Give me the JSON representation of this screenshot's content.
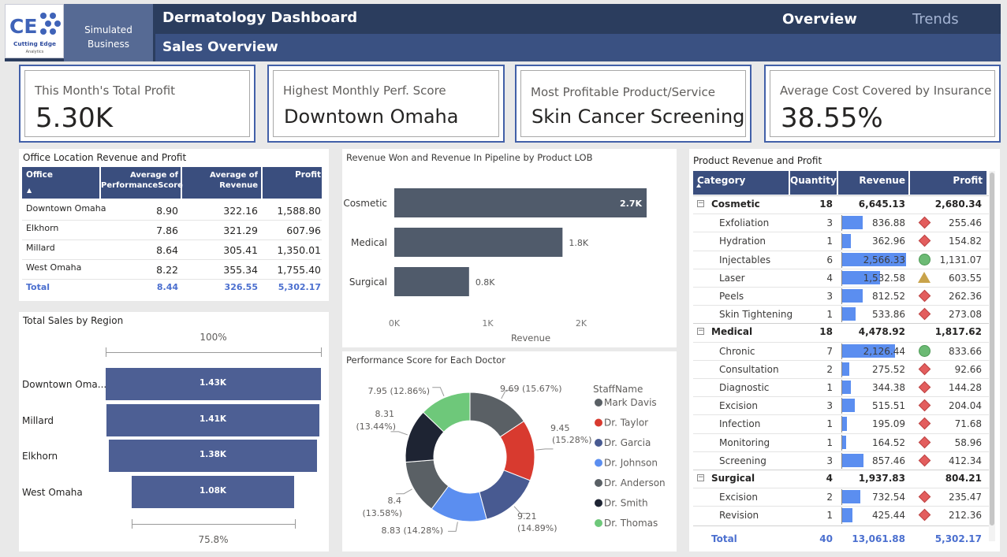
{
  "header": {
    "logo_text": "Cutting Edge",
    "logo_sub": "Analytics",
    "simulated_line1": "Simulated",
    "simulated_line2": "Business",
    "title": "Dermatology Dashboard",
    "subtitle": "Sales Overview",
    "nav_overview": "Overview",
    "nav_trends": "Trends"
  },
  "kpis": [
    {
      "label": "This Month's Total Profit",
      "value": "5.30K"
    },
    {
      "label": "Highest Monthly Perf. Score",
      "value": "Downtown Omaha"
    },
    {
      "label": "Most Profitable Product/Service",
      "value": "Skin Cancer Screening"
    },
    {
      "label": "Average Cost Covered by Insurance",
      "value": "38.55%"
    }
  ],
  "office_table": {
    "title": "Office Location Revenue and Profit",
    "headers": [
      "Office",
      "Average of PerformanceScore",
      "Average of Revenue",
      "Profit"
    ],
    "rows": [
      [
        "Downtown Omaha",
        "8.90",
        "322.16",
        "1,588.80"
      ],
      [
        "Elkhorn",
        "7.86",
        "321.29",
        "607.96"
      ],
      [
        "Millard",
        "8.64",
        "305.41",
        "1,350.01"
      ],
      [
        "West Omaha",
        "8.22",
        "355.34",
        "1,755.40"
      ]
    ],
    "total": [
      "Total",
      "8.44",
      "326.55",
      "5,302.17"
    ]
  },
  "region_funnel": {
    "title": "Total Sales by Region",
    "top_label": "100%",
    "bottom_label": "75.8%",
    "rows": [
      {
        "name": "Downtown Oma...",
        "value": 1430,
        "label": "1.43K"
      },
      {
        "name": "Millard",
        "value": 1410,
        "label": "1.41K"
      },
      {
        "name": "Elkhorn",
        "value": 1380,
        "label": "1.38K"
      },
      {
        "name": "West Omaha",
        "value": 1080,
        "label": "1.08K"
      }
    ]
  },
  "chart_data": [
    {
      "type": "bar",
      "title": "Revenue Won and Revenue In Pipeline by Product LOB",
      "orientation": "horizontal",
      "categories": [
        "Cosmetic",
        "Medical",
        "Surgical"
      ],
      "values": [
        2700,
        1800,
        800
      ],
      "data_labels": [
        "2.7K",
        "1.8K",
        "0.8K"
      ],
      "xlabel": "Revenue",
      "xticks": [
        "0K",
        "1K",
        "2K"
      ],
      "xlim": [
        0,
        2700
      ],
      "color": "#505b6b"
    },
    {
      "type": "pie",
      "title": "Performance Score for Each Doctor",
      "donut": true,
      "legend_title": "StaffName",
      "legend_position": "right",
      "slices": [
        {
          "name": "Mark Davis",
          "value": 9.69,
          "label": "9.69 (15.67%)",
          "color": "#5a6065"
        },
        {
          "name": "Dr. Taylor",
          "value": 9.45,
          "label_a": "9.45",
          "label_b": "(15.28%)",
          "color": "#d83a2f"
        },
        {
          "name": "Dr. Garcia",
          "value": 9.21,
          "label_a": "9.21",
          "label_b": "(14.89%)",
          "color": "#485a91"
        },
        {
          "name": "Dr. Johnson",
          "value": 8.83,
          "label": "8.83 (14.28%)",
          "color": "#5b8ef0"
        },
        {
          "name": "Dr. Anderson",
          "value": 8.4,
          "label_a": "8.4",
          "label_b": "(13.58%)",
          "color": "#5a6065"
        },
        {
          "name": "Dr. Smith",
          "value": 8.31,
          "label_a": "8.31",
          "label_b": "(13.44%)",
          "color": "#1e2433"
        },
        {
          "name": "Dr. Thomas",
          "value": 7.95,
          "label": "7.95 (12.86%)",
          "color": "#6ec87a"
        }
      ]
    }
  ],
  "product_table": {
    "title": "Product Revenue and Profit",
    "headers": [
      "Category",
      "Quantity",
      "Revenue",
      "Profit"
    ],
    "max_revenue": 2566.33,
    "groups": [
      {
        "name": "Cosmetic",
        "qty": "18",
        "revenue": "6,645.13",
        "profit": "2,680.34",
        "items": [
          {
            "name": "Exfoliation",
            "qty": "3",
            "revenue": "836.88",
            "rev": 836.88,
            "profit": "255.46",
            "kpi": "diamond"
          },
          {
            "name": "Hydration",
            "qty": "1",
            "revenue": "362.96",
            "rev": 362.96,
            "profit": "154.82",
            "kpi": "diamond"
          },
          {
            "name": "Injectables",
            "qty": "6",
            "revenue": "2,566.33",
            "rev": 2566.33,
            "profit": "1,131.07",
            "kpi": "circle"
          },
          {
            "name": "Laser",
            "qty": "4",
            "revenue": "1,532.58",
            "rev": 1532.58,
            "profit": "603.55",
            "kpi": "triangle"
          },
          {
            "name": "Peels",
            "qty": "3",
            "revenue": "812.52",
            "rev": 812.52,
            "profit": "262.36",
            "kpi": "diamond"
          },
          {
            "name": "Skin Tightening",
            "qty": "1",
            "revenue": "533.86",
            "rev": 533.86,
            "profit": "273.08",
            "kpi": "diamond"
          }
        ]
      },
      {
        "name": "Medical",
        "qty": "18",
        "revenue": "4,478.92",
        "profit": "1,817.62",
        "items": [
          {
            "name": "Chronic",
            "qty": "7",
            "revenue": "2,126.44",
            "rev": 2126.44,
            "profit": "833.66",
            "kpi": "circle"
          },
          {
            "name": "Consultation",
            "qty": "2",
            "revenue": "275.52",
            "rev": 275.52,
            "profit": "92.66",
            "kpi": "diamond"
          },
          {
            "name": "Diagnostic",
            "qty": "1",
            "revenue": "344.38",
            "rev": 344.38,
            "profit": "144.28",
            "kpi": "diamond"
          },
          {
            "name": "Excision",
            "qty": "3",
            "revenue": "515.51",
            "rev": 515.51,
            "profit": "204.04",
            "kpi": "diamond"
          },
          {
            "name": "Infection",
            "qty": "1",
            "revenue": "195.09",
            "rev": 195.09,
            "profit": "71.68",
            "kpi": "diamond"
          },
          {
            "name": "Monitoring",
            "qty": "1",
            "revenue": "164.52",
            "rev": 164.52,
            "profit": "58.96",
            "kpi": "diamond"
          },
          {
            "name": "Screening",
            "qty": "3",
            "revenue": "857.46",
            "rev": 857.46,
            "profit": "412.34",
            "kpi": "diamond"
          }
        ]
      },
      {
        "name": "Surgical",
        "qty": "4",
        "revenue": "1,937.83",
        "profit": "804.21",
        "items": [
          {
            "name": "Excision",
            "qty": "2",
            "revenue": "732.54",
            "rev": 732.54,
            "profit": "235.47",
            "kpi": "diamond"
          },
          {
            "name": "Revision",
            "qty": "1",
            "revenue": "425.44",
            "rev": 425.44,
            "profit": "212.36",
            "kpi": "diamond"
          }
        ]
      }
    ],
    "total": [
      "Total",
      "40",
      "13,061.88",
      "5,302.17"
    ]
  },
  "colors": {
    "navy": "#2b3d5e",
    "header_blue": "#3a4e7e",
    "accent": "#4260a8",
    "bar_blue": "#5b8ef0",
    "funnel_blue": "#4d5f94",
    "diamond_red": "#e35d5d",
    "circle_green": "#6cba74",
    "triangle_gold": "#c9a34a",
    "total_blue": "#4b6fcf"
  }
}
